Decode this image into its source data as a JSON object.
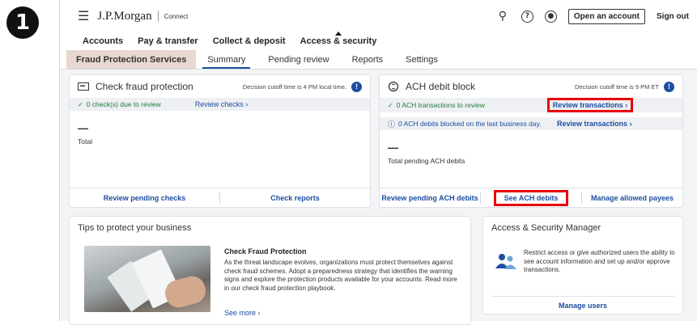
{
  "step_badge": "1",
  "header": {
    "brand": "J.P.Morgan",
    "brand_sub": "Connect",
    "open_account": "Open an account",
    "sign_out": "Sign out",
    "icons": [
      "menu-icon",
      "search-icon",
      "help-icon",
      "profile-icon"
    ]
  },
  "nav": {
    "items": [
      "Accounts",
      "Pay & transfer",
      "Collect & deposit",
      "Access & security"
    ],
    "active": "Access & security"
  },
  "subnav": {
    "section": "Fraud Protection Services",
    "tabs": [
      "Summary",
      "Pending review",
      "Reports",
      "Settings"
    ],
    "active": "Summary"
  },
  "check_card": {
    "title": "Check fraud protection",
    "cutoff": "Decision cutoff time is 4 PM local time.",
    "status": "0 check(s) due to review",
    "review_link": "Review checks",
    "dash": "—",
    "total_label": "Total",
    "footer_links": [
      "Review pending checks",
      "Check reports"
    ]
  },
  "ach_card": {
    "title": "ACH debit block",
    "cutoff": "Decision cutoff time is 9 PM ET",
    "status": "0 ACH transactions to review",
    "review_link": "Review transactions",
    "blocked_text": "0 ACH debits blocked on the last business day.",
    "review_link2": "Review transactions",
    "dash": "—",
    "total_label": "Total pending ACH debits",
    "footer_links": [
      "Review pending ACH debits",
      "See ACH debits",
      "Manage allowed payees"
    ]
  },
  "tips_card": {
    "title": "Tips to protect your business",
    "heading": "Check Fraud Protection",
    "body": "As the threat landscape evolves, organizations must protect themselves against check fraud schemes. Adopt a preparedness strategy that identifies the warning signs and explore the protection products available for your accounts. Read more in our check fraud protection playbook.",
    "see_more": "See more"
  },
  "asm_card": {
    "title": "Access & Security Manager",
    "body": "Restrict access or give authorized users the ability to see account information and set up and/or approve transactions.",
    "footer_link": "Manage users"
  },
  "colors": {
    "accent": "#1c4ea0",
    "highlight_box": "#e8000b",
    "section_tab_bg": "#e8d8d1",
    "success": "#1e7b3c"
  }
}
